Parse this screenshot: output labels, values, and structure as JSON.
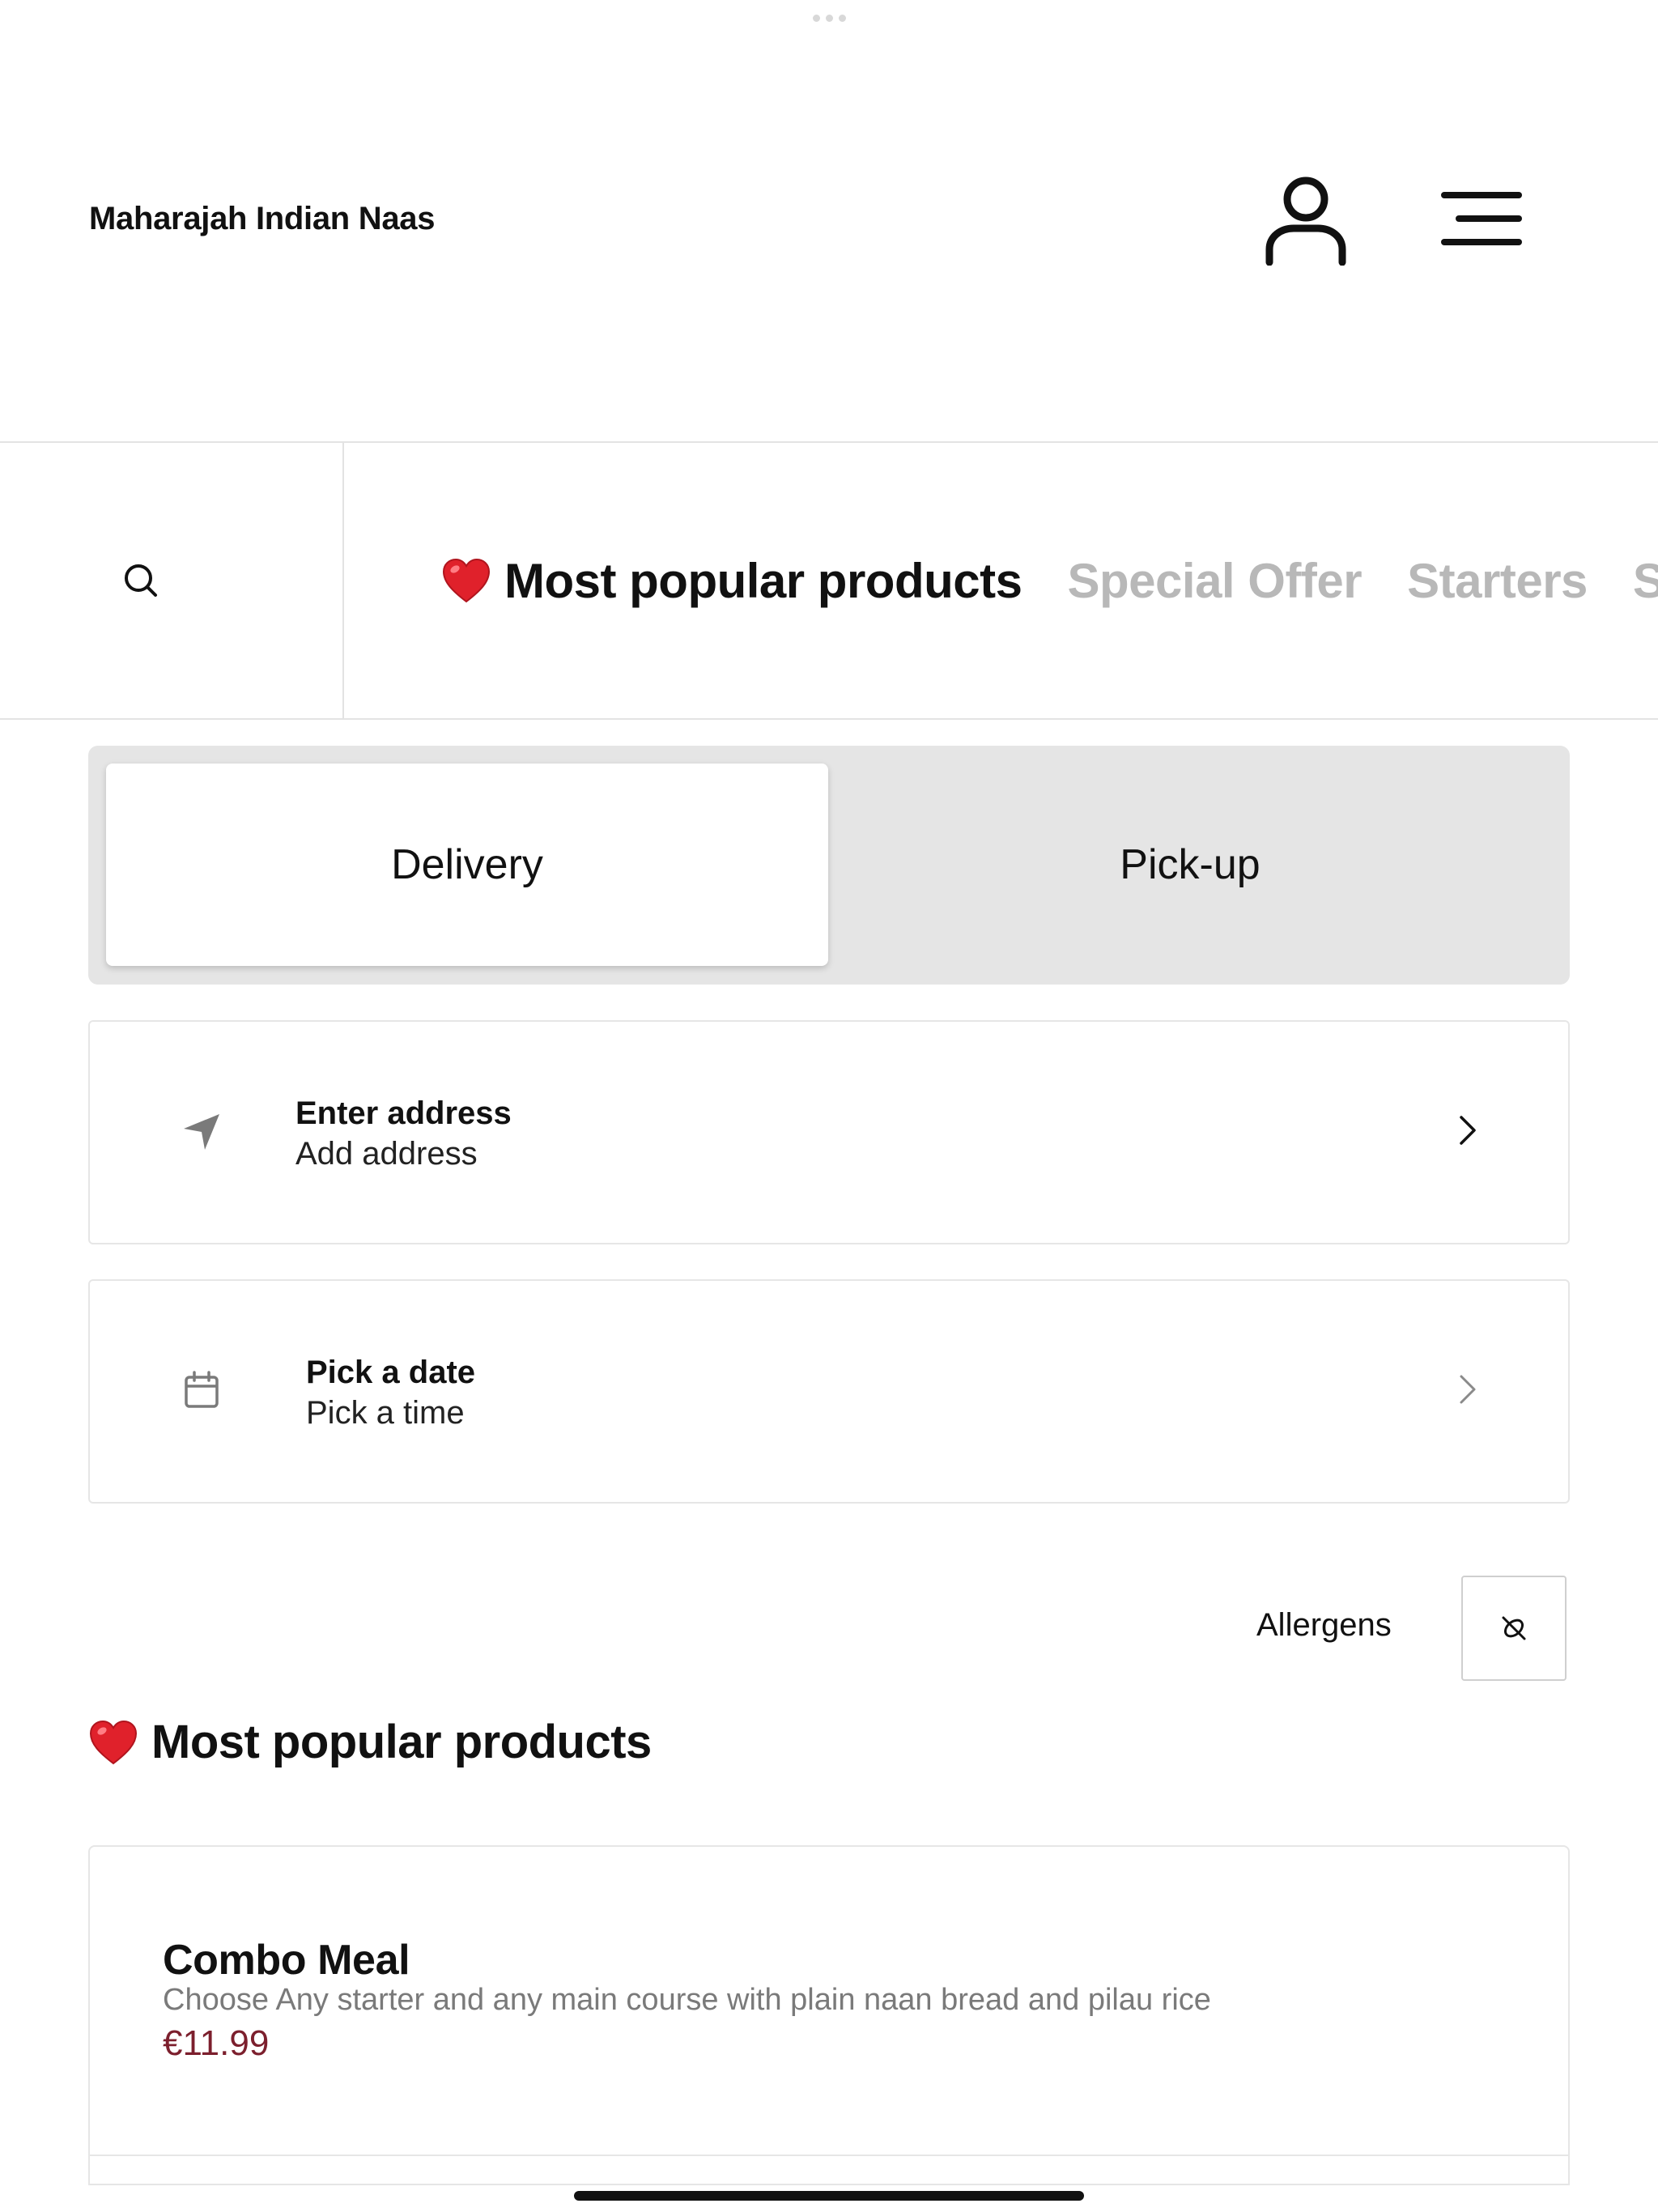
{
  "header": {
    "shop_name": "Maharajah Indian Naas",
    "account_icon": "person-icon",
    "menu_icon": "hamburger-menu-icon"
  },
  "category_nav": {
    "search_icon": "search-icon",
    "tabs": [
      {
        "label": "Most popular products",
        "active": true,
        "icon": "heart-emoji"
      },
      {
        "label": "Special Offer",
        "active": false
      },
      {
        "label": "Starters",
        "active": false
      },
      {
        "label": "S",
        "active": false
      }
    ]
  },
  "order_mode": {
    "options": [
      "Delivery",
      "Pick-up"
    ],
    "selected": "Delivery"
  },
  "address_row": {
    "icon": "location-arrow-icon",
    "title": "Enter address",
    "subtitle": "Add address"
  },
  "date_row": {
    "icon": "calendar-icon",
    "title": "Pick a date",
    "subtitle": "Pick a time"
  },
  "allergens": {
    "label": "Allergens",
    "icon": "allergen-filter-icon"
  },
  "section": {
    "title": "Most popular products",
    "icon": "heart-emoji"
  },
  "products": [
    {
      "name": "Combo Meal",
      "description": "Choose Any starter and any main course with plain naan bread and pilau rice",
      "price": "€11.99"
    }
  ],
  "colors": {
    "price": "#7c1f2d",
    "inactive_tab": "#b8b8b8",
    "segment_bg": "#e5e5e5",
    "heart": "#e0212b"
  }
}
